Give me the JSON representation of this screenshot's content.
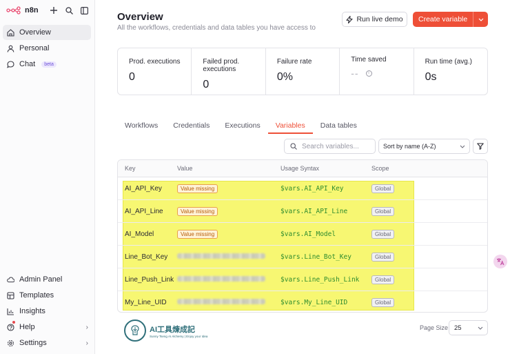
{
  "sidebar": {
    "brand": "n8n",
    "items": [
      {
        "label": "Overview",
        "icon": "home-icon",
        "active": true
      },
      {
        "label": "Personal",
        "icon": "user-icon"
      },
      {
        "label": "Chat",
        "icon": "chat-icon",
        "badge": "beta"
      }
    ],
    "bottom_items": [
      {
        "label": "Admin Panel",
        "icon": "cloud-icon"
      },
      {
        "label": "Templates",
        "icon": "templates-icon"
      },
      {
        "label": "Insights",
        "icon": "insights-icon"
      },
      {
        "label": "Help",
        "icon": "help-icon"
      },
      {
        "label": "Settings",
        "icon": "gear-icon"
      }
    ]
  },
  "header": {
    "title": "Overview",
    "subtitle": "All the workflows, credentials and data tables you have access to",
    "run_demo_label": "Run live demo",
    "create_label": "Create variable"
  },
  "stats": [
    {
      "label": "Prod. executions",
      "value": "0"
    },
    {
      "label": "Failed prod. executions",
      "value": "0"
    },
    {
      "label": "Failure rate",
      "value": "0%"
    },
    {
      "label": "Time saved",
      "value": "--"
    },
    {
      "label": "Run time (avg.)",
      "value": "0s"
    }
  ],
  "tabs": [
    "Workflows",
    "Credentials",
    "Executions",
    "Variables",
    "Data tables"
  ],
  "active_tab": "Variables",
  "search": {
    "placeholder": "Search variables..."
  },
  "sort": {
    "selected": "Sort by name (A-Z)"
  },
  "table": {
    "headers": [
      "Key",
      "Value",
      "Usage Syntax",
      "Scope"
    ],
    "rows": [
      {
        "key": "AI_API_Key",
        "value": "Value missing",
        "syntax": "$vars.AI_API_Key",
        "scope": "Global"
      },
      {
        "key": "AI_API_Line",
        "value": "Value missing",
        "syntax": "$vars.AI_API_Line",
        "scope": "Global"
      },
      {
        "key": "AI_Model",
        "value": "Value missing",
        "syntax": "$vars.AI_Model",
        "scope": "Global"
      },
      {
        "key": "Line_Bot_Key",
        "value": "",
        "syntax": "$vars.Line_Bot_Key",
        "scope": "Global"
      },
      {
        "key": "Line_Push_Link",
        "value": "",
        "syntax": "$vars.Line_Push_Link",
        "scope": "Global"
      },
      {
        "key": "My_Line_UID",
        "value": "",
        "syntax": "$vars.My_Line_UID",
        "scope": "Global"
      }
    ]
  },
  "footer": {
    "logo_title": "AI工具煉成記",
    "logo_tagline": "Sunny Tseng AI Alchemy | Enjoy your Idea",
    "page_size_label": "Page Size",
    "page_size_value": "25"
  },
  "colors": {
    "accent": "#ee4f37",
    "syntax_green": "#2f8c2f",
    "highlight": "#f7f772"
  }
}
